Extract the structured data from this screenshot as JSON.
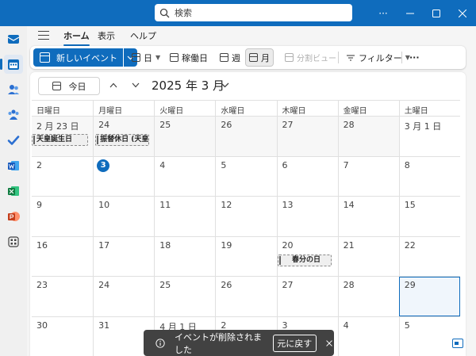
{
  "search": {
    "placeholder": "検索"
  },
  "window": {
    "more": "···"
  },
  "menu": {
    "tabs": [
      "ホーム",
      "表示",
      "ヘルプ"
    ]
  },
  "ribbon": {
    "new_event": "新しいイベント",
    "day": "日",
    "work_week": "稼働日",
    "week": "週",
    "month": "月",
    "split_view": "分割ビュー",
    "filter": "フィルター",
    "more": "···"
  },
  "calendar": {
    "today_label": "今日",
    "month_title": "2025 年 3 月",
    "weekdays": [
      "日曜日",
      "月曜日",
      "火曜日",
      "水曜日",
      "木曜日",
      "金曜日",
      "土曜日"
    ],
    "weeks": [
      [
        "2 月 23 日",
        "24",
        "25",
        "26",
        "27",
        "28",
        "3 月 1 日"
      ],
      [
        "2",
        "3",
        "4",
        "5",
        "6",
        "7",
        "8"
      ],
      [
        "9",
        "10",
        "11",
        "12",
        "13",
        "14",
        "15"
      ],
      [
        "16",
        "17",
        "18",
        "19",
        "20",
        "21",
        "22"
      ],
      [
        "23",
        "24",
        "25",
        "26",
        "27",
        "28",
        "29"
      ],
      [
        "30",
        "31",
        "4 月 1 日",
        "2",
        "3",
        "4",
        "5"
      ]
    ],
    "today_date": "3",
    "selected_date": "29",
    "events": {
      "emperor_birthday": "天皇誕生日",
      "substitute_holiday": "振替休日 (天皇誕生日)",
      "vernal_equinox": "春分の日"
    }
  },
  "toast": {
    "message": "イベントが削除されました",
    "undo": "元に戻す"
  },
  "colors": {
    "accent": "#0f6cbd",
    "toast_bg": "#424242"
  }
}
